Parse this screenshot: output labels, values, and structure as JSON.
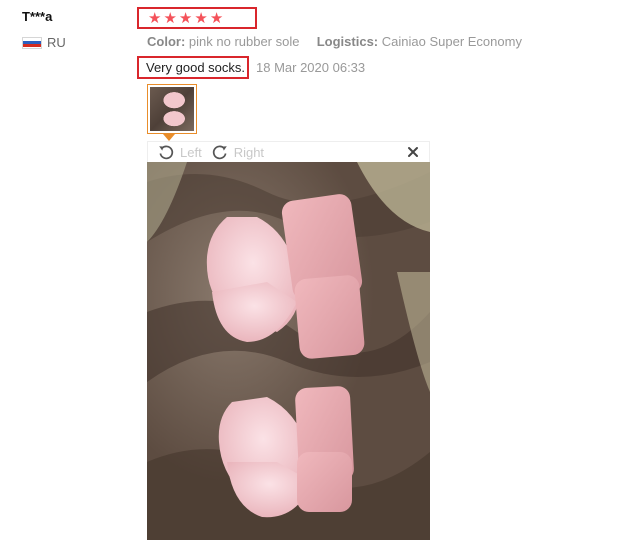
{
  "review": {
    "reviewer_name": "T***a",
    "country_code": "RU",
    "rating": 5,
    "star_glyph": "★",
    "color_key": "Color:",
    "color_value": "pink no rubber sole",
    "logistics_key": "Logistics:",
    "logistics_value": "Cainiao Super Economy",
    "feedback_text": "Very good socks.",
    "date": "18 Mar 2020 06:33"
  },
  "viewer": {
    "rotate_left_label": "Left",
    "rotate_right_label": "Right",
    "close_glyph": "×",
    "icons": {
      "rotate_left": "rotate-left-icon",
      "rotate_right": "rotate-right-icon",
      "close": "close-icon"
    }
  },
  "colors": {
    "highlight_border": "#d9262c",
    "star": "#f4525a",
    "thumb_border": "#e98d2a",
    "muted_text": "#999999"
  }
}
